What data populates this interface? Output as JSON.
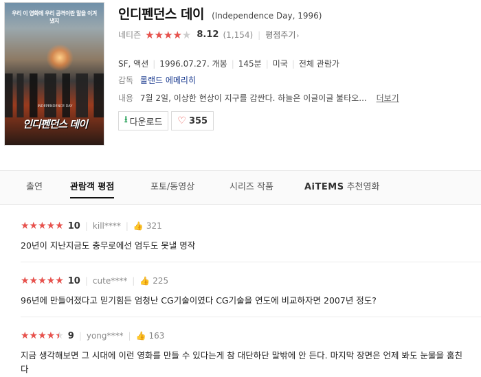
{
  "poster": {
    "tagline": "우리 이 영화에 우리 공격이란 말을 이겨냈지",
    "small_text": "INDEPENDENCE DAY",
    "title": "인디펜던스 데이"
  },
  "movie": {
    "title": "인디펜던스 데이",
    "original_title": "(Independence Day, 1996)",
    "rating_source": "네티즌",
    "rating_fraction": 0.812,
    "score": "8.12",
    "rating_count": "(1,154)",
    "rate_button": "평점주기",
    "genre": "SF, 액션",
    "release": "1996.07.27. 개봉",
    "runtime": "145분",
    "country": "미국",
    "age_rating": "전체 관람가",
    "director_label": "감독",
    "director": "롤랜드 에메리히",
    "desc_label": "내용",
    "description": "7월 2일, 이상한 현상이 지구를 감싼다. 하늘은 이글이글 불타오...",
    "more_link": "더보기",
    "download_label": "다운로드",
    "like_count": "355"
  },
  "tabs": [
    {
      "label": "출연"
    },
    {
      "label": "관람객 평점"
    },
    {
      "label": "포토/동영상"
    },
    {
      "label": "시리즈 작품"
    },
    {
      "brand": "AiTEMS",
      "label": "추천영화"
    }
  ],
  "active_tab": "관람객 평점",
  "reviews": [
    {
      "rating_fraction": 1.0,
      "score": "10",
      "user": "kill****",
      "likes": "321",
      "text": "20년이 지난지금도 충무로에선 엄두도 못낼 명작"
    },
    {
      "rating_fraction": 1.0,
      "score": "10",
      "user": "cute****",
      "likes": "225",
      "text": "96년에 만들어졌다고 믿기힘든 엄청난 CG기술이였다 CG기술을 연도에 비교하자면 2007년 정도?"
    },
    {
      "rating_fraction": 0.9,
      "score": "9",
      "user": "yong****",
      "likes": "163",
      "text": "지금 생각해보면 그 시대에 이런 영화를 만들 수 있다는게 참 대단하단 말밖에 안 든다. 마지막 장면은 언제 봐도 눈물을 훔친다"
    }
  ],
  "colors": {
    "star_fill": "#e8514c",
    "director_link": "#1a3a8f",
    "download_icon": "#2aa25b"
  }
}
